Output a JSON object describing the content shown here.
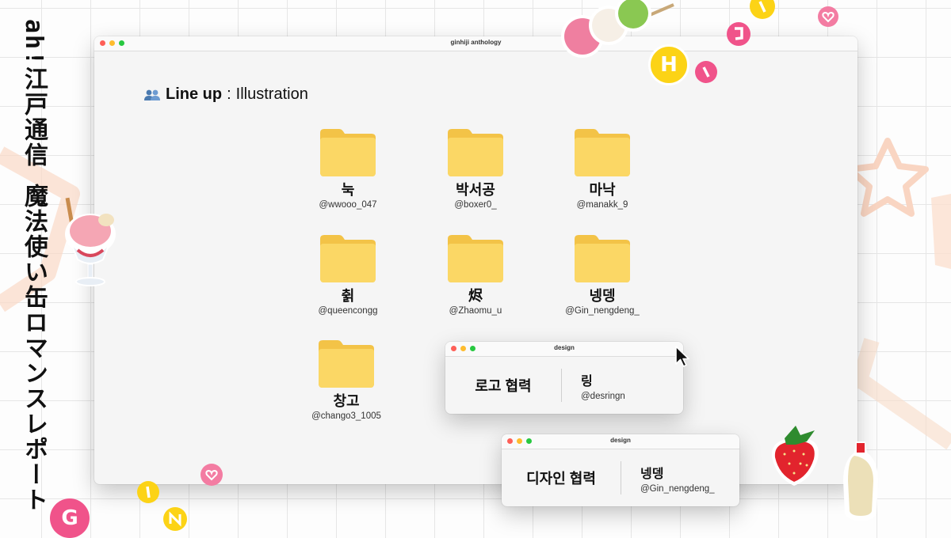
{
  "side_text": "ah!江戸通信 魔法使い缶ロマンスレポート",
  "window": {
    "title": "ginhiji anthology"
  },
  "heading": {
    "strong": "Line up",
    "separator": ":",
    "light": "Illustration"
  },
  "folders": [
    {
      "name": "눅",
      "handle": "@wwooo_047"
    },
    {
      "name": "박서공",
      "handle": "@boxer0_"
    },
    {
      "name": "마낙",
      "handle": "@manakk_9"
    },
    {
      "name": "췱",
      "handle": "@queencongg"
    },
    {
      "name": "烬",
      "handle": "@Zhaomu_u"
    },
    {
      "name": "넹뎅",
      "handle": "@Gin_nengdeng_"
    },
    {
      "name": "창고",
      "handle": "@chango3_1005"
    }
  ],
  "popups": [
    {
      "title": "design",
      "left": "로고 협력",
      "name": "링",
      "handle": "@desringn"
    },
    {
      "title": "design",
      "left": "디자인 협력",
      "name": "넹뎅",
      "handle": "@Gin_nengdeng_"
    }
  ],
  "badges": {
    "h": "H",
    "g": "G"
  },
  "colors": {
    "folder": "#fbd765",
    "folder_dark": "#f3c347",
    "pink": "#f0538a",
    "yellow": "#fcd316",
    "close": "#fe5f57",
    "min": "#febc2e",
    "max": "#28c840"
  }
}
